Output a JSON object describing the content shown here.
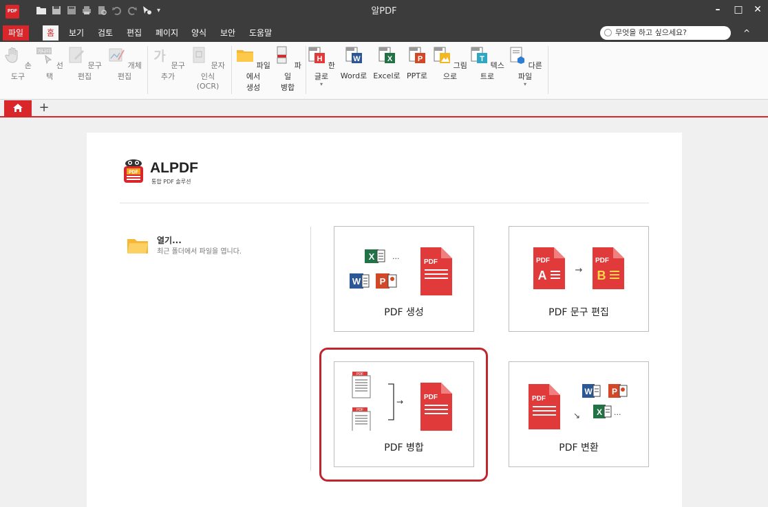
{
  "app": {
    "logo_text": "PDF",
    "title": "알PDF"
  },
  "window_controls": [
    "–",
    "□",
    "✕"
  ],
  "menu": {
    "items": [
      "파일",
      "홈",
      "보기",
      "검토",
      "편집",
      "페이지",
      "양식",
      "보안",
      "도움말"
    ],
    "active": "홈",
    "search_placeholder": "무엇을 하고 싶으세요?",
    "collapse": "^"
  },
  "ribbon": {
    "buttons": [
      {
        "label": "손 도구",
        "icon": "hand-icon"
      },
      {
        "label": "선택",
        "icon": "select-text-icon"
      },
      {
        "label": "문구 편집",
        "icon": "edit-text-icon"
      },
      {
        "label": "개체 편집",
        "icon": "edit-object-icon"
      },
      {
        "label": "문구 추가",
        "icon": "add-text-icon"
      },
      {
        "label": "문자인식",
        "label2": "(OCR)",
        "icon": "ocr-icon"
      },
      {
        "label": "파일에서",
        "label2": "생성",
        "icon": "folder-icon"
      },
      {
        "label": "파일",
        "label2": "병합",
        "icon": "merge-icon"
      },
      {
        "label": "한글로",
        "icon": "hwp-icon"
      },
      {
        "label": "Word로",
        "icon": "word-icon"
      },
      {
        "label": "Excel로",
        "icon": "excel-icon"
      },
      {
        "label": "PPT로",
        "icon": "ppt-icon"
      },
      {
        "label": "그림으로",
        "icon": "image-icon"
      },
      {
        "label": "텍스트로",
        "icon": "text-icon"
      },
      {
        "label": "다른 파일",
        "icon": "other-file-icon"
      }
    ]
  },
  "tabs": {
    "home_icon": "home-icon",
    "add": "+"
  },
  "start_page": {
    "brand_title": "ALPDF",
    "brand_subtitle": "통합 PDF 솔루션",
    "open_title": "열기...",
    "open_desc": "최근 폴더에서 파일을 엽니다.",
    "cards": [
      {
        "label": "PDF 생성"
      },
      {
        "label": "PDF 문구 편집"
      },
      {
        "label": "PDF 병합"
      },
      {
        "label": "PDF 변환"
      }
    ],
    "card_art": {
      "pdf": "PDF",
      "x": "X",
      "w": "W",
      "p": "P",
      "a": "A",
      "b": "B",
      "ellipsis": "...",
      "arrow_right": "→",
      "arrow_down_right": "↘"
    }
  },
  "colors": {
    "accent": "#d8262b",
    "titlebar": "#3c3c3c",
    "highlight": "#c0252e"
  }
}
